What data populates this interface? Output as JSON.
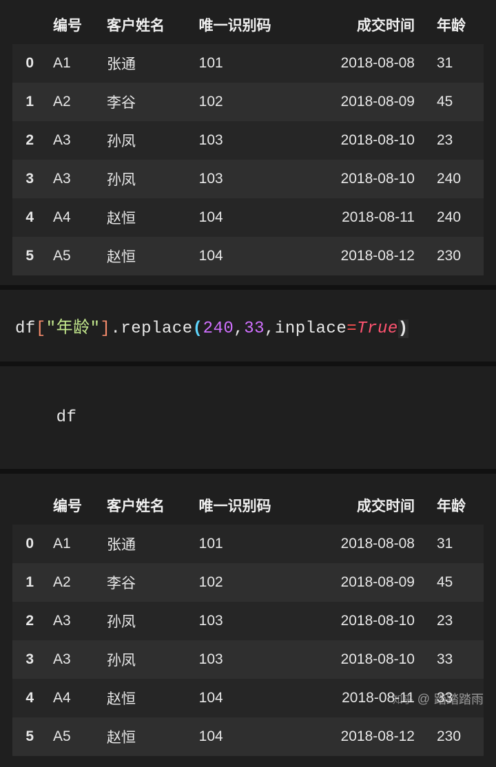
{
  "headers": {
    "bh": "编号",
    "xm": "客户姓名",
    "uid": "唯一识别码",
    "time": "成交时间",
    "age": "年龄"
  },
  "table1": {
    "rows": [
      {
        "idx": "0",
        "bh": "A1",
        "xm": "张通",
        "uid": "101",
        "time": "2018-08-08",
        "age": "31"
      },
      {
        "idx": "1",
        "bh": "A2",
        "xm": "李谷",
        "uid": "102",
        "time": "2018-08-09",
        "age": "45"
      },
      {
        "idx": "2",
        "bh": "A3",
        "xm": "孙凤",
        "uid": "103",
        "time": "2018-08-10",
        "age": "23"
      },
      {
        "idx": "3",
        "bh": "A3",
        "xm": "孙凤",
        "uid": "103",
        "time": "2018-08-10",
        "age": "240"
      },
      {
        "idx": "4",
        "bh": "A4",
        "xm": "赵恒",
        "uid": "104",
        "time": "2018-08-11",
        "age": "240"
      },
      {
        "idx": "5",
        "bh": "A5",
        "xm": "赵恒",
        "uid": "104",
        "time": "2018-08-12",
        "age": "230"
      }
    ]
  },
  "code1": {
    "prefix": "df",
    "bracket_o": "[",
    "string": "\"年龄\"",
    "bracket_c": "]",
    "dot": ".",
    "method": "replace",
    "paren_o": "(",
    "arg1": "240",
    "comma1": ",",
    "arg2": "33",
    "comma2": ",",
    "kwarg": "inplace",
    "eq": "=",
    "bool": "True",
    "paren_c": ")"
  },
  "code2": {
    "text": "df"
  },
  "table2": {
    "rows": [
      {
        "idx": "0",
        "bh": "A1",
        "xm": "张通",
        "uid": "101",
        "time": "2018-08-08",
        "age": "31"
      },
      {
        "idx": "1",
        "bh": "A2",
        "xm": "李谷",
        "uid": "102",
        "time": "2018-08-09",
        "age": "45"
      },
      {
        "idx": "2",
        "bh": "A3",
        "xm": "孙凤",
        "uid": "103",
        "time": "2018-08-10",
        "age": "23"
      },
      {
        "idx": "3",
        "bh": "A3",
        "xm": "孙凤",
        "uid": "103",
        "time": "2018-08-10",
        "age": "33"
      },
      {
        "idx": "4",
        "bh": "A4",
        "xm": "赵恒",
        "uid": "104",
        "time": "2018-08-11",
        "age": "33"
      },
      {
        "idx": "5",
        "bh": "A5",
        "xm": "赵恒",
        "uid": "104",
        "time": "2018-08-12",
        "age": "230"
      }
    ]
  },
  "watermark": {
    "site": "知乎",
    "at": "@",
    "user": "踏踏踏雨"
  }
}
